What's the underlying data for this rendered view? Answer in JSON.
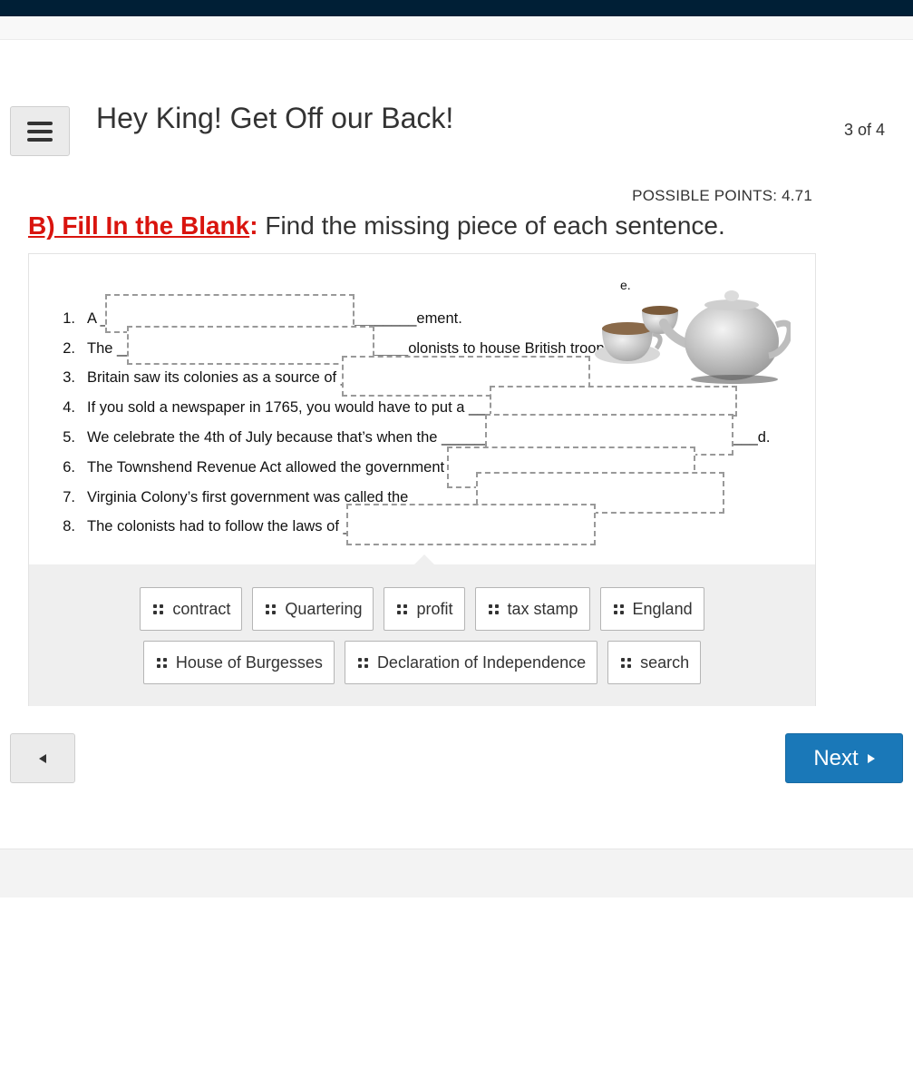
{
  "header": {
    "menu_icon": "hamburger-menu-icon",
    "title": "Hey King! Get Off our Back!",
    "page_counter": "3 of 4"
  },
  "question": {
    "points": "POSSIBLE POINTS: 4.71",
    "label": "B) Fill In the Blank",
    "label_colon": ":",
    "instruction": " Find the missing piece of each sentence.",
    "label_color": "#d9140e"
  },
  "sentences": [
    {
      "num": "1.",
      "text": "A ______________________________________ement."
    },
    {
      "num": "2.",
      "text": "The ___________________________________olonists to house British troops."
    },
    {
      "num": "3.",
      "text": "Britain saw its colonies as a source of ___"
    },
    {
      "num": "4.",
      "text": "If you sold a newspaper in 1765, you would have to put a ___"
    },
    {
      "num": "5.",
      "text": "We celebrate the 4th of July because that’s when the ______________________________________d."
    },
    {
      "num": "6.",
      "text": "The Townshend Revenue Act allowed the government ___"
    },
    {
      "num": "7.",
      "text": "Virginia Colony’s first government was called the ________"
    },
    {
      "num": "8.",
      "text": "The colonists had to follow the laws of ___"
    }
  ],
  "stray_text": "e.",
  "image": {
    "icon": "teapot-and-teacups-illustration"
  },
  "word_bank": {
    "row1": [
      "contract",
      "Quartering",
      "profit",
      "tax stamp",
      "England"
    ],
    "row2": [
      "House of Burgesses",
      "Declaration of Independence",
      "search"
    ],
    "chip_icon": "drag-handle-icon"
  },
  "nav": {
    "prev_icon": "left-triangle-icon",
    "next_label": "Next",
    "next_icon": "right-triangle-icon",
    "next_color": "#1a78b8"
  }
}
